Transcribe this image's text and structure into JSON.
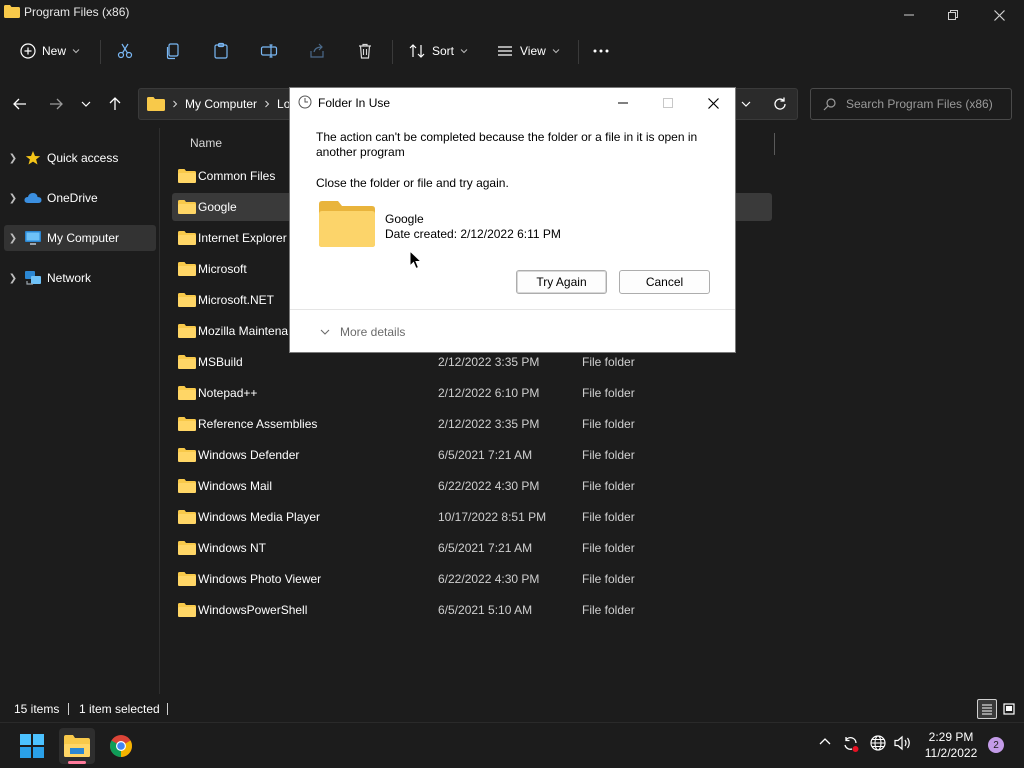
{
  "window": {
    "title": "Program Files (x86)"
  },
  "toolbar": {
    "new_label": "New",
    "sort_label": "Sort",
    "view_label": "View"
  },
  "address": {
    "segments": [
      "My Computer",
      "Lo"
    ]
  },
  "search": {
    "placeholder": "Search Program Files (x86)"
  },
  "sidebar": {
    "items": [
      {
        "label": "Quick access",
        "icon": "star-icon"
      },
      {
        "label": "OneDrive",
        "icon": "cloud-icon"
      },
      {
        "label": "My Computer",
        "icon": "computer-icon",
        "selected": true
      },
      {
        "label": "Network",
        "icon": "network-icon"
      }
    ]
  },
  "filelist": {
    "header_name": "Name",
    "rows": [
      {
        "name": "Common Files",
        "date": "",
        "type": ""
      },
      {
        "name": "Google",
        "date": "",
        "type": "",
        "selected": true
      },
      {
        "name": "Internet Explorer",
        "date": "",
        "type": ""
      },
      {
        "name": "Microsoft",
        "date": "",
        "type": ""
      },
      {
        "name": "Microsoft.NET",
        "date": "",
        "type": ""
      },
      {
        "name": "Mozilla Maintena",
        "date": "",
        "type": ""
      },
      {
        "name": "MSBuild",
        "date": "2/12/2022 3:35 PM",
        "type": "File folder"
      },
      {
        "name": "Notepad++",
        "date": "2/12/2022 6:10 PM",
        "type": "File folder"
      },
      {
        "name": "Reference Assemblies",
        "date": "2/12/2022 3:35 PM",
        "type": "File folder"
      },
      {
        "name": "Windows Defender",
        "date": "6/5/2021 7:21 AM",
        "type": "File folder"
      },
      {
        "name": "Windows Mail",
        "date": "6/22/2022 4:30 PM",
        "type": "File folder"
      },
      {
        "name": "Windows Media Player",
        "date": "10/17/2022 8:51 PM",
        "type": "File folder"
      },
      {
        "name": "Windows NT",
        "date": "6/5/2021 7:21 AM",
        "type": "File folder"
      },
      {
        "name": "Windows Photo Viewer",
        "date": "6/22/2022 4:30 PM",
        "type": "File folder"
      },
      {
        "name": "WindowsPowerShell",
        "date": "6/5/2021 5:10 AM",
        "type": "File folder"
      }
    ]
  },
  "status": {
    "items_count": "15 items",
    "selected_count": "1 item selected"
  },
  "dialog": {
    "title": "Folder In Use",
    "message": "The action can't be completed because the folder or a file in it is open in another program",
    "instruction": "Close the folder or file and try again.",
    "folder_name": "Google",
    "folder_date": "Date created: 2/12/2022 6:11 PM",
    "try_again_label": "Try Again",
    "cancel_label": "Cancel",
    "more_details_label": "More details"
  },
  "taskbar": {
    "time": "2:29 PM",
    "date": "11/2/2022",
    "notification_count": "2"
  },
  "colors": {
    "background": "#1c1c1c",
    "folder_yellow": "#f8c94a",
    "selection": "#3a3a3a",
    "badge": "#c39be8"
  }
}
